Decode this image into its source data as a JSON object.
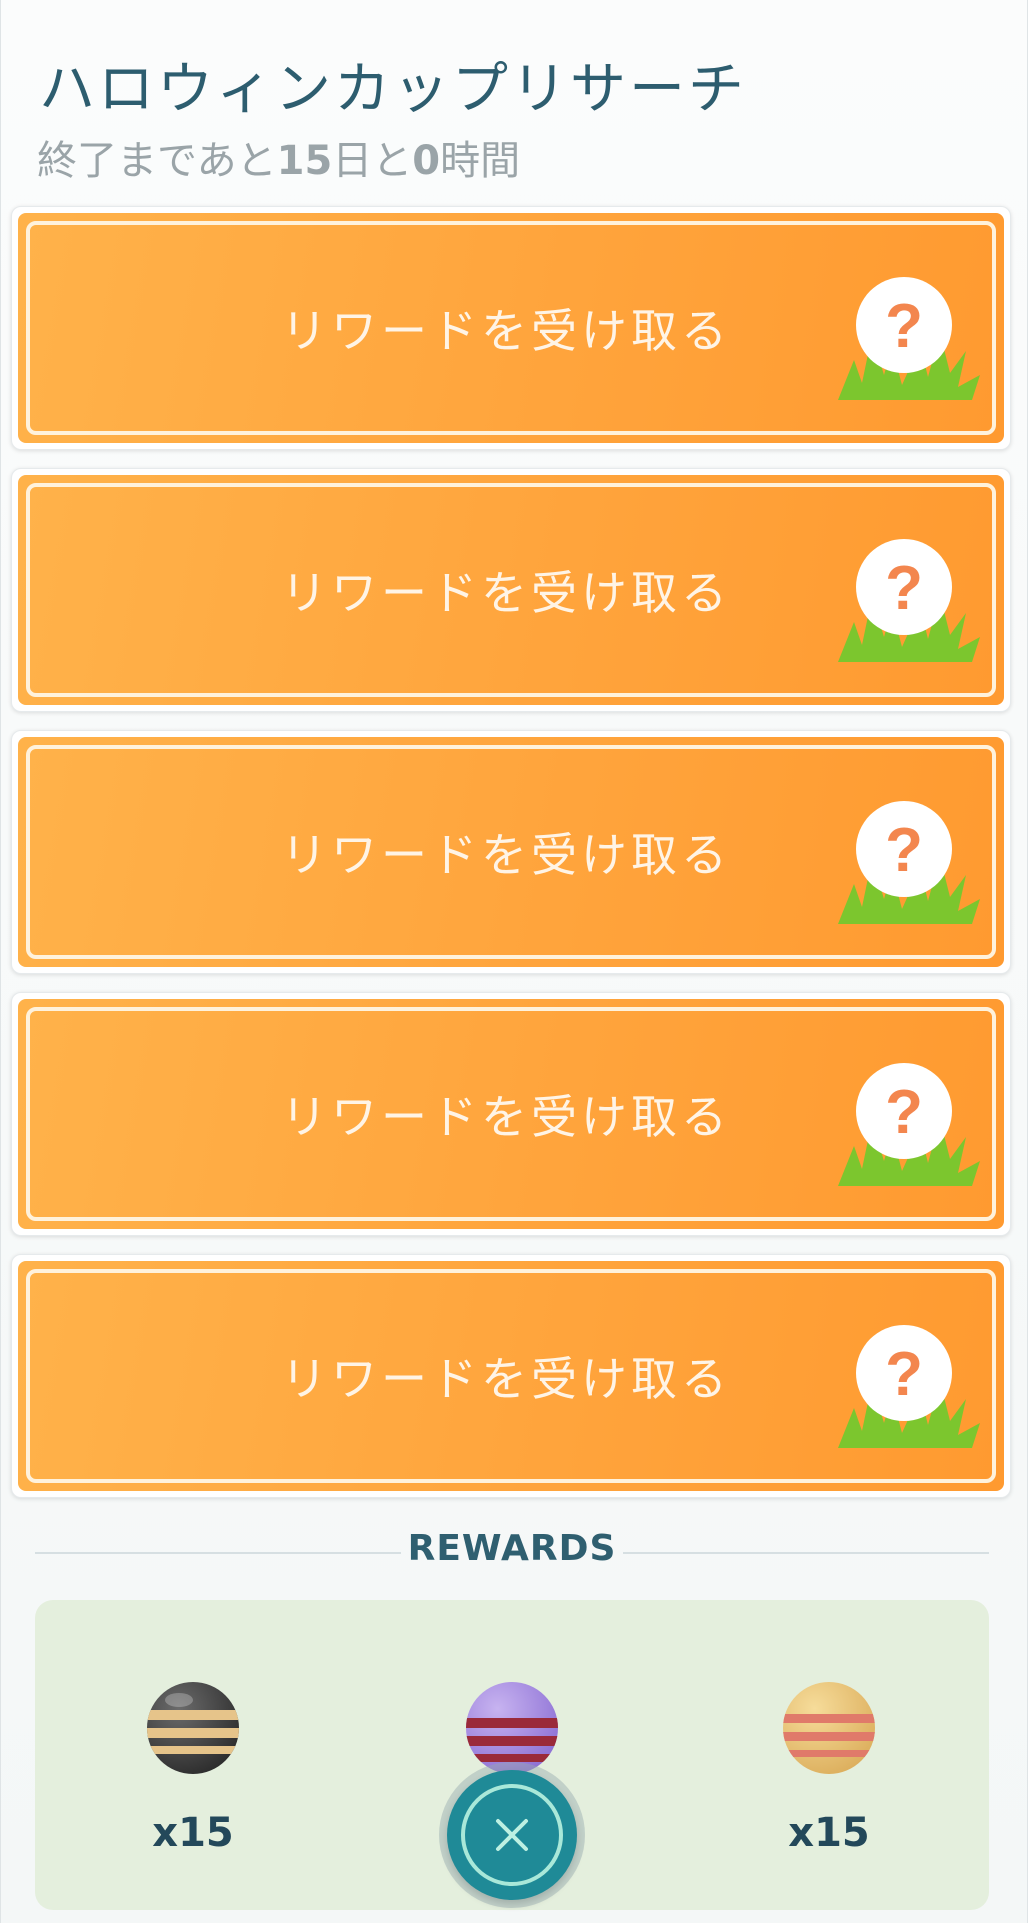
{
  "header": {
    "title": "ハロウィンカップリサーチ",
    "time_left_prefix": "終了まであと",
    "days": "15",
    "days_unit": "日と",
    "hours": "0",
    "hours_unit": "時間"
  },
  "tasks": [
    {
      "label": "リワードを受け取る",
      "icon": "mystery-encounter-icon"
    },
    {
      "label": "リワードを受け取る",
      "icon": "mystery-encounter-icon"
    },
    {
      "label": "リワードを受け取る",
      "icon": "mystery-encounter-icon"
    },
    {
      "label": "リワードを受け取る",
      "icon": "mystery-encounter-icon"
    },
    {
      "label": "リワードを受け取る",
      "icon": "mystery-encounter-icon"
    }
  ],
  "rewards": {
    "heading": "REWARDS",
    "items": [
      {
        "qty": "x15",
        "icon": "dark-striped-candy-icon"
      },
      {
        "qty": "",
        "icon": "purple-striped-candy-icon"
      },
      {
        "qty": "x15",
        "icon": "yellow-striped-candy-icon"
      }
    ]
  },
  "colors": {
    "accent": "#2d5d6f",
    "task_orange": "#ffa43c",
    "rewards_bg": "#e4efdd",
    "close_teal": "#1f8a97"
  },
  "close_icon": "close-icon"
}
